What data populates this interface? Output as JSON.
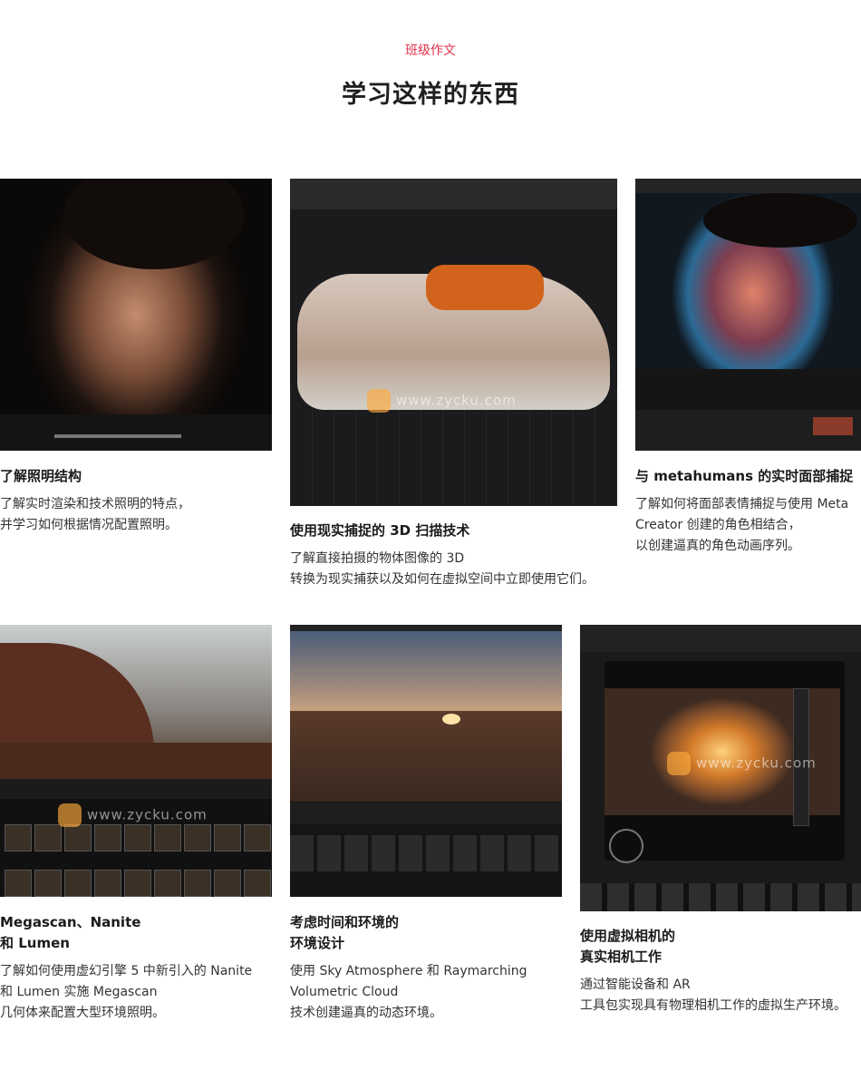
{
  "header": {
    "eyebrow": "班级作文",
    "headline": "学习这样的东西"
  },
  "watermark": "www.zycku.com",
  "cards": [
    {
      "title": "了解照明结构",
      "desc": [
        "了解实时渲染和技术照明的特点，",
        "并学习如何根据情况配置照明。"
      ]
    },
    {
      "title": "使用现实捕捉的 3D 扫描技术",
      "desc": [
        "了解直接拍摄的物体图像的 3D",
        "转换为现实捕获以及如何在虚拟空间中立即使用它们。"
      ]
    },
    {
      "title": "与 metahumans 的实时面部捕捉",
      "desc": [
        "了解如何将面部表情捕捉与使用 Meta",
        "Creator 创建的角色相结合，",
        "以创建逼真的角色动画序列。"
      ]
    },
    {
      "title": [
        "Megascan、Nanite",
        "和 Lumen"
      ],
      "desc": [
        "了解如何使用虚幻引擎 5 中新引入的 Nanite",
        "和 Lumen 实施 Megascan",
        "几何体来配置大型环境照明。"
      ]
    },
    {
      "title": [
        "考虑时间和环境的",
        "环境设计"
      ],
      "desc": [
        "使用 Sky Atmosphere 和 Raymarching",
        "Volumetric Cloud",
        "技术创建逼真的动态环境。"
      ]
    },
    {
      "title": [
        "使用虚拟相机的",
        "真实相机工作"
      ],
      "desc": [
        "通过智能设备和 AR",
        "工具包实现具有物理相机工作的虚拟生产环境。"
      ]
    }
  ],
  "colors": {
    "accent": "#e0314b",
    "headline": "#1f1f1f"
  }
}
